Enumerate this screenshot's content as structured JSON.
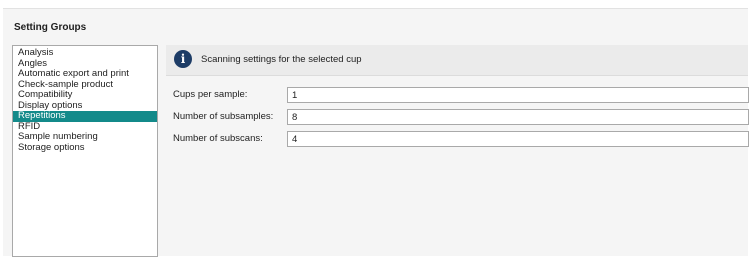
{
  "title": "Setting Groups",
  "sidebar": {
    "items": [
      {
        "label": "Analysis"
      },
      {
        "label": "Angles"
      },
      {
        "label": "Automatic export and print"
      },
      {
        "label": "Check-sample product"
      },
      {
        "label": "Compatibility"
      },
      {
        "label": "Display options"
      },
      {
        "label": "Repetitions",
        "selected": true
      },
      {
        "label": "RFID"
      },
      {
        "label": "Sample numbering"
      },
      {
        "label": "Storage options"
      }
    ],
    "selected_color": "#138a8a"
  },
  "info_bar": {
    "icon": "info-icon",
    "text": "Scanning settings for the selected cup"
  },
  "fields": [
    {
      "label": "Cups per sample:",
      "value": "1"
    },
    {
      "label": "Number of subsamples:",
      "value": "8"
    },
    {
      "label": "Number of subscans:",
      "value": "4"
    }
  ]
}
